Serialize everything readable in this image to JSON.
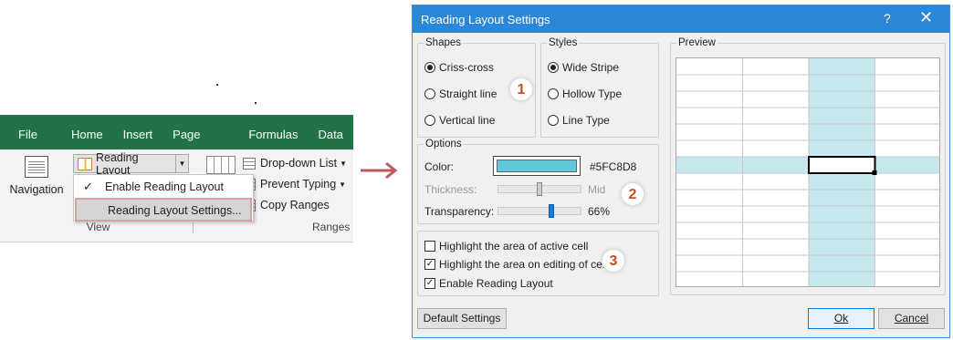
{
  "ribbon": {
    "tabs": [
      "File",
      "Home",
      "Insert",
      "Page Layout",
      "Formulas",
      "Data"
    ],
    "navigation_label": "Navigation",
    "reading_layout_label": "Reading Layout",
    "menu": {
      "enable_label": "Enable Reading Layout",
      "enable_checked": true,
      "settings_label": "Reading Layout Settings..."
    },
    "dropdown_list_label": "Drop-down List",
    "prevent_typing_label": "Prevent Typing",
    "copy_ranges_label": "Copy Ranges",
    "group_view": "View",
    "group_ranges": "Ranges"
  },
  "dialog": {
    "title": "Reading Layout Settings",
    "help": "?",
    "close": "✕",
    "shapes": {
      "legend": "Shapes",
      "options": [
        "Criss-cross",
        "Straight line",
        "Vertical line"
      ],
      "selected": "Criss-cross"
    },
    "styles": {
      "legend": "Styles",
      "options": [
        "Wide Stripe",
        "Hollow Type",
        "Line Type"
      ],
      "selected": "Wide Stripe"
    },
    "options": {
      "legend": "Options",
      "color_label": "Color:",
      "color_value": "#5FC8D8",
      "thickness_label": "Thickness:",
      "thickness_value": "Mid",
      "transparency_label": "Transparency:",
      "transparency_value": "66%",
      "thickness_level": 0.5,
      "transparency_level": 0.66
    },
    "checkboxes": [
      {
        "label": "Highlight the area of active cell",
        "checked": false
      },
      {
        "label": "Highlight the area on editing of cell",
        "checked": true
      },
      {
        "label": "Enable Reading Layout",
        "checked": true
      }
    ],
    "preview_legend": "Preview",
    "badges": [
      "1",
      "2",
      "3"
    ],
    "buttons": {
      "default": "Default Settings",
      "ok": "Ok",
      "cancel": "Cancel"
    },
    "highlight_color": "#c5e8ef"
  }
}
